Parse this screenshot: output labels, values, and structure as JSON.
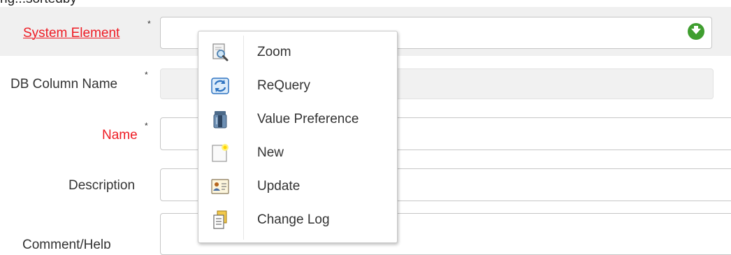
{
  "header": {
    "partial_text": "ng...sortedby"
  },
  "fields": {
    "system_element": {
      "label": "System Element",
      "required_mark": "*",
      "value": ""
    },
    "db_column_name": {
      "label": "DB Column Name",
      "required_mark": "*",
      "value": ""
    },
    "name": {
      "label": "Name",
      "required_mark": "*",
      "value": ""
    },
    "description": {
      "label": "Description",
      "value": ""
    },
    "comment_help": {
      "label": "Comment/Help",
      "value": ""
    }
  },
  "popup_menu": {
    "items": [
      {
        "label": "Zoom",
        "icon": "zoom-icon"
      },
      {
        "label": "ReQuery",
        "icon": "requery-icon"
      },
      {
        "label": "Value Preference",
        "icon": "value-preference-icon"
      },
      {
        "label": "New",
        "icon": "new-icon"
      },
      {
        "label": "Update",
        "icon": "update-icon"
      },
      {
        "label": "Change Log",
        "icon": "change-log-icon"
      }
    ]
  },
  "colors": {
    "mandatory_label": "#ee1c24",
    "row_highlight": "#f0f0f0",
    "search_arrow": "#3f9e2f"
  }
}
